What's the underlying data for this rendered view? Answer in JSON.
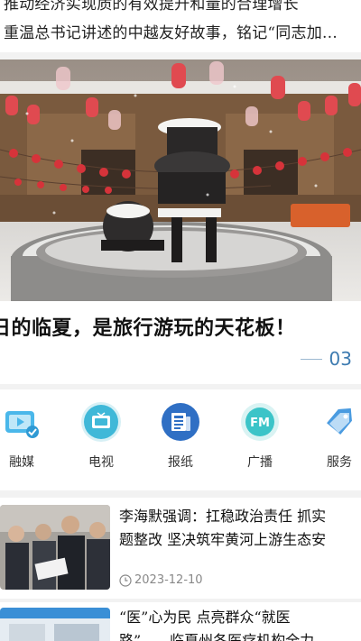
{
  "headlines": [
    "推动经济实现质的有效提升和量的合理增长",
    "重温总书记讲述的中越友好故事，铭记“同志加…"
  ],
  "banner": {
    "title": "日的临夏，是旅行游玩的天花板！",
    "page": "03"
  },
  "categories": [
    {
      "label": "融媒",
      "icon": "media-icon",
      "color": "#4ab7ea"
    },
    {
      "label": "电视",
      "icon": "tv-icon",
      "color": "#3fb8d8"
    },
    {
      "label": "报纸",
      "icon": "newspaper-icon",
      "color": "#2f6fc4"
    },
    {
      "label": "广播",
      "icon": "fm-radio-icon",
      "color": "#3cc4c8"
    },
    {
      "label": "服务",
      "icon": "service-tag-icon",
      "color": "#4a9be0"
    }
  ],
  "news": [
    {
      "title_lines": [
        "李海默强调：扛稳政治责任 抓实",
        "题整改 坚决筑牢黄河上游生态安"
      ],
      "date": "2023-12-10"
    },
    {
      "title_lines": [
        "“医”心为民 点亮群众“就医",
        "路”——临夏州各医疗机构全力…"
      ]
    }
  ]
}
